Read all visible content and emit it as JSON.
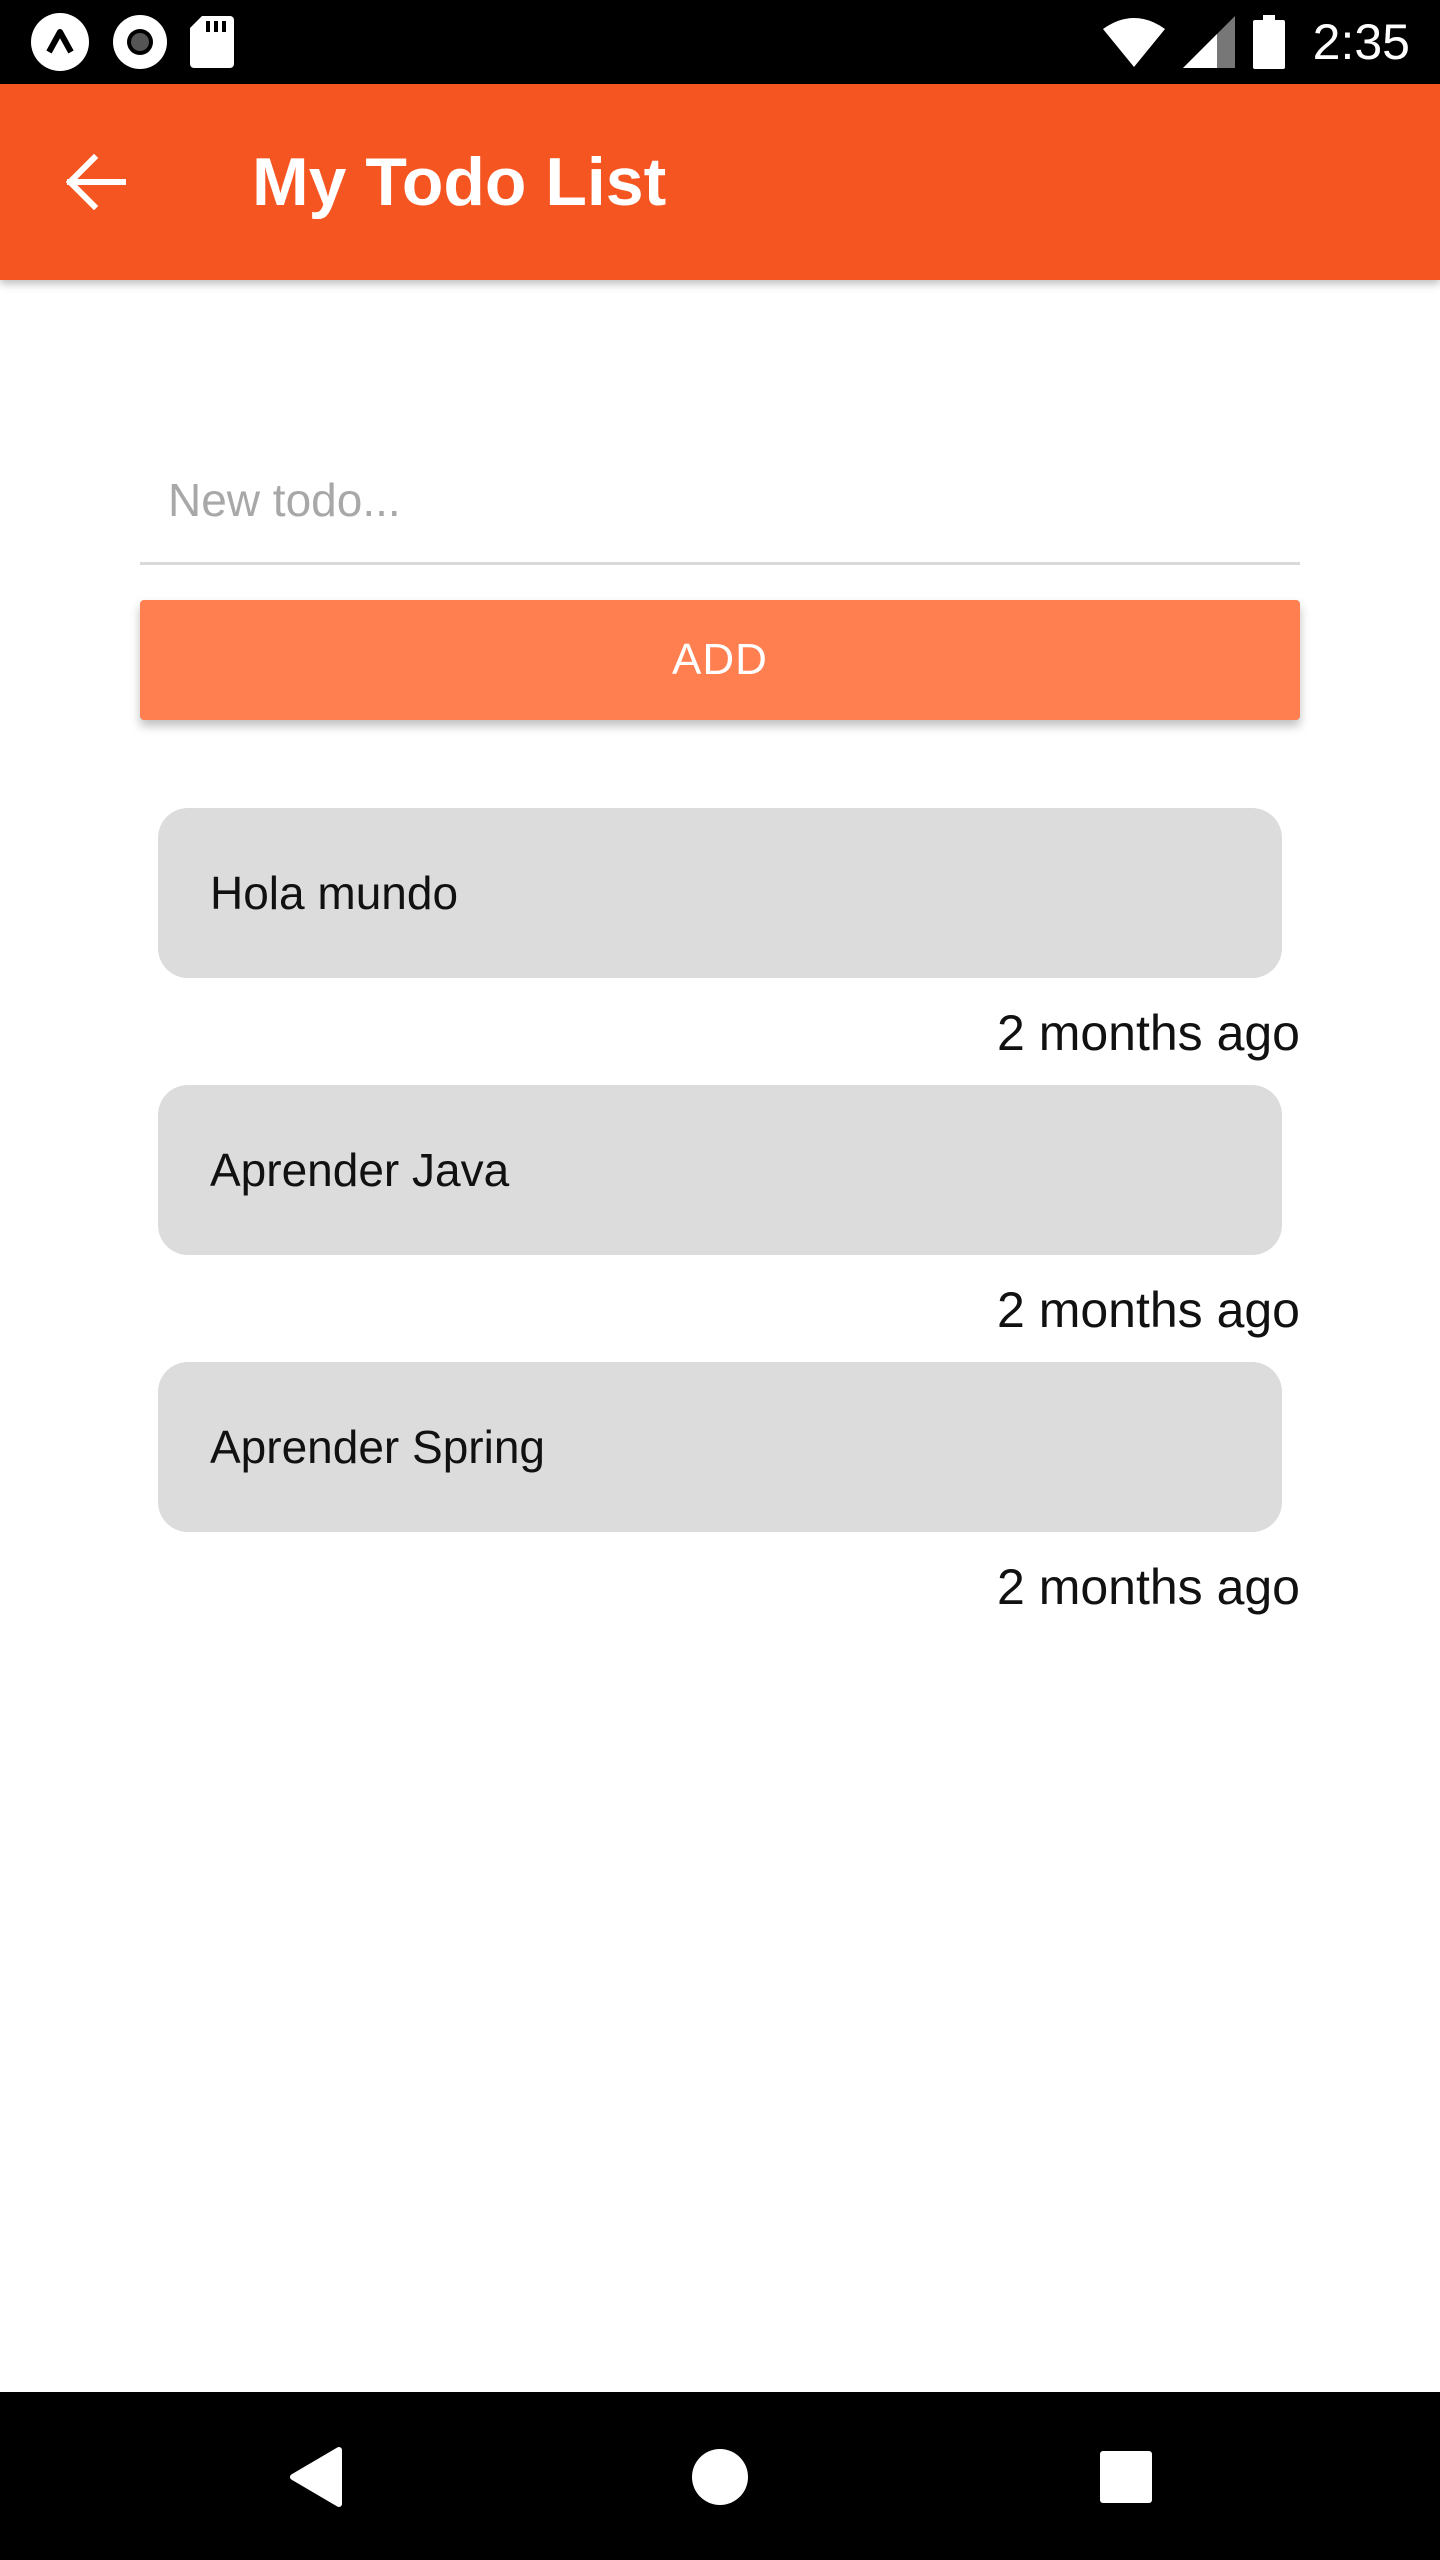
{
  "status_bar": {
    "time": "2:35",
    "left_icons": [
      "notification-icon",
      "record-icon",
      "sd-card-icon"
    ],
    "right_icons": [
      "wifi-icon",
      "signal-icon",
      "battery-icon"
    ]
  },
  "app_bar": {
    "title": "My Todo List",
    "back_icon": "arrow-back-icon",
    "color": "#f55521"
  },
  "form": {
    "input_value": "",
    "input_placeholder": "New todo...",
    "add_label": "ADD",
    "add_color": "#ff7f50"
  },
  "todos": [
    {
      "text": "Hola mundo",
      "time": "2 months ago"
    },
    {
      "text": "Aprender Java",
      "time": "2 months ago"
    },
    {
      "text": "Aprender Spring",
      "time": "2 months ago"
    }
  ],
  "nav_bar": {
    "icons": [
      "back-triangle-icon",
      "home-circle-icon",
      "recents-square-icon"
    ]
  }
}
